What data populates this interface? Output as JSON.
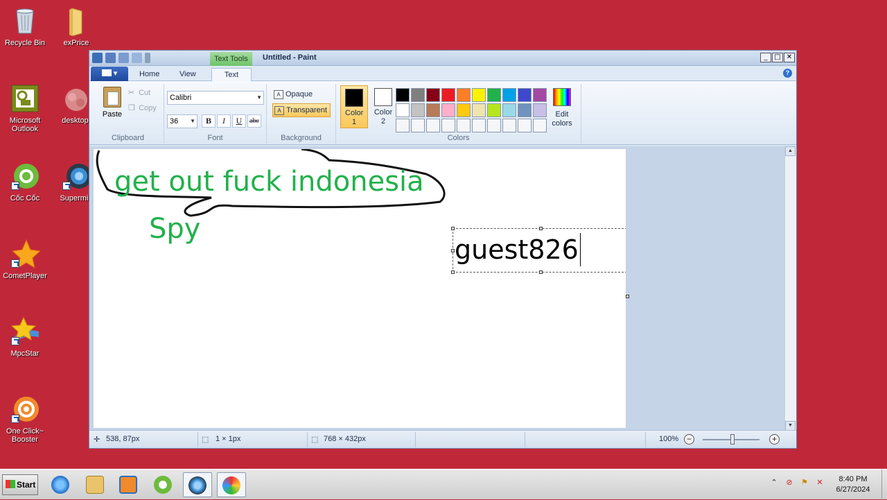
{
  "desktop": {
    "icons": [
      {
        "label": "Recycle Bin",
        "icon": "recycle-bin-icon"
      },
      {
        "label": "exPrice",
        "icon": "folder-icon"
      },
      {
        "label": "Microsoft Outlook",
        "icon": "outlook-icon"
      },
      {
        "label": "desktop.",
        "icon": "image-file-icon"
      },
      {
        "label": "Cốc Cốc",
        "icon": "coccoc-browser-icon"
      },
      {
        "label": "Supermiu",
        "icon": "browser-globe-icon"
      },
      {
        "label": "CometPlayer",
        "icon": "comet-player-icon"
      },
      {
        "label": "MpcStar",
        "icon": "mpcstar-icon"
      },
      {
        "label": "One Click~ Booster",
        "icon": "booster-icon"
      }
    ]
  },
  "window": {
    "context_tab": "Text Tools",
    "title": "Untitled - Paint",
    "controls": {
      "minimize": "_",
      "maximize": "□",
      "close": "✕"
    }
  },
  "ribbon": {
    "file_menu": "▾",
    "tabs": [
      "Home",
      "View",
      "Text"
    ],
    "active_tab": "Text",
    "help": "?",
    "clipboard": {
      "paste": "Paste",
      "cut": "Cut",
      "copy": "Copy",
      "label": "Clipboard"
    },
    "font": {
      "family": "Calibri",
      "size": "36",
      "bold": "B",
      "italic": "I",
      "underline": "U",
      "strikethrough": "abc",
      "label": "Font"
    },
    "background": {
      "opaque": "Opaque",
      "transparent": "Transparent",
      "selected": "Transparent",
      "label": "Background"
    },
    "colors": {
      "color1_label": "Color 1",
      "color1": "#000000",
      "color2_label": "Color 2",
      "color2": "#ffffff",
      "edit_colors": "Edit colors",
      "label": "Colors",
      "palette": [
        "#000000",
        "#7f7f7f",
        "#880015",
        "#ed1c24",
        "#ff7f27",
        "#fff200",
        "#22b14c",
        "#00a2e8",
        "#3f48cc",
        "#a349a4",
        "#ffffff",
        "#c3c3c3",
        "#b97a57",
        "#ffaec9",
        "#ffc90e",
        "#efe4b0",
        "#b5e61d",
        "#99d9ea",
        "#7092be",
        "#c8bfe7",
        "#f4f6fa",
        "#f4f6fa",
        "#f4f6fa",
        "#f4f6fa",
        "#f4f6fa",
        "#f4f6fa",
        "#f4f6fa",
        "#f4f6fa",
        "#f4f6fa",
        "#f4f6fa"
      ]
    }
  },
  "canvas": {
    "text_main": "get out fuck indonesia",
    "text_spy": "Spy",
    "text_box": "guest826",
    "text_color": "#22b14c"
  },
  "status": {
    "cursor_pos": "538, 87px",
    "selection_size": "1 × 1px",
    "image_size": "768 × 432px",
    "zoom": "100%"
  },
  "taskbar": {
    "start": "Start",
    "apps": [
      "internet-explorer-icon",
      "file-explorer-icon",
      "media-player-icon",
      "coccoc-browser-icon",
      "browser-globe-icon",
      "paint-icon"
    ],
    "time": "8:40 PM",
    "date": "6/27/2024"
  }
}
